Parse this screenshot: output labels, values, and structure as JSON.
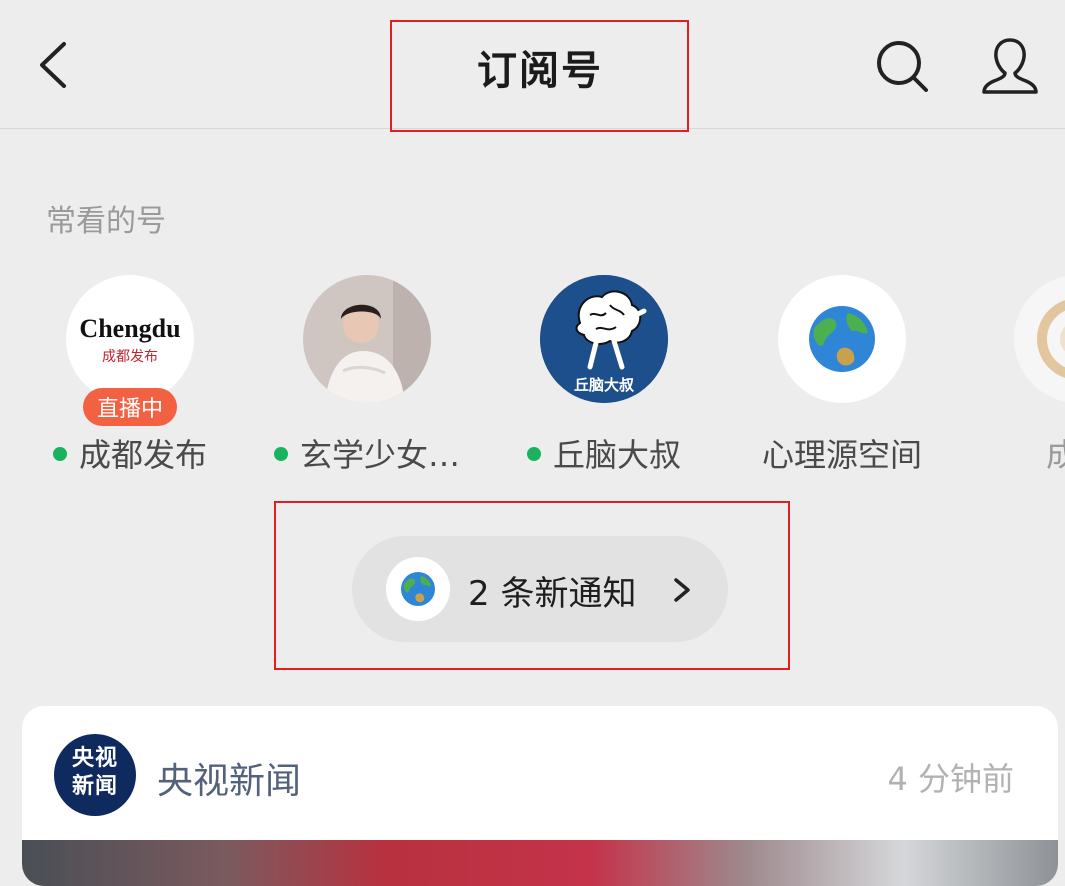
{
  "header": {
    "title": "订阅号"
  },
  "frequent": {
    "label": "常看的号",
    "accounts": [
      {
        "name": "成都发布",
        "live_badge": "直播中",
        "logo_text": "Chengdu",
        "logo_subtext": "成都发布",
        "has_update": true
      },
      {
        "name": "玄学少女…",
        "has_update": true
      },
      {
        "name": "丘脑大叔",
        "logo_text": "丘脑大叔",
        "has_update": true
      },
      {
        "name": "心理源空间",
        "has_update": false
      },
      {
        "name": "成都",
        "has_update": false
      }
    ]
  },
  "notification": {
    "label": "2 条新通知"
  },
  "feed": {
    "source": "央视新闻",
    "logo_line1": "央视",
    "logo_line2": "新闻",
    "time": "4 分钟前"
  },
  "colors": {
    "online_dot": "#19b35d",
    "live_badge": "#f26141",
    "highlight_box": "#e02020"
  },
  "icons": [
    "back-arrow-icon",
    "search-icon",
    "profile-icon",
    "globe-icon",
    "chevron-right-icon"
  ]
}
